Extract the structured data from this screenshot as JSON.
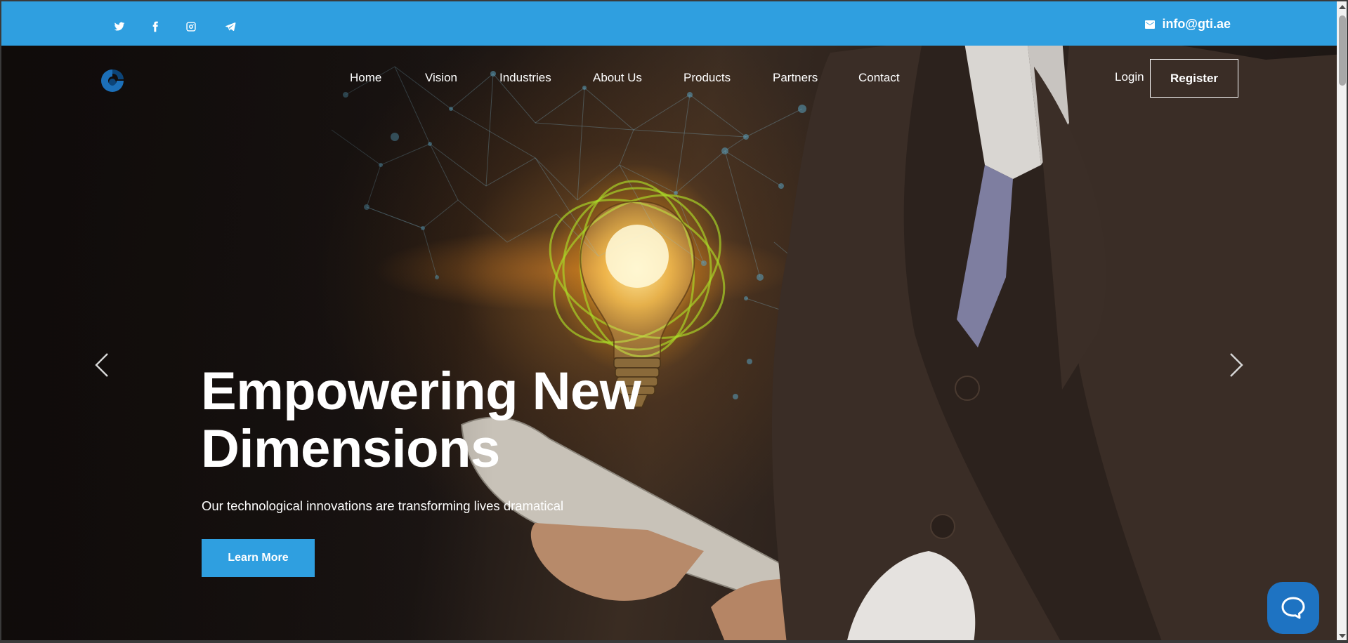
{
  "topbar": {
    "social": [
      {
        "icon": "twitter-icon"
      },
      {
        "icon": "facebook-icon"
      },
      {
        "icon": "instagram-icon"
      },
      {
        "icon": "telegram-icon"
      }
    ],
    "email": "info@gti.ae",
    "bg_color": "#2f9fe0"
  },
  "nav": {
    "items": [
      "Home",
      "Vision",
      "Industries",
      "About Us",
      "Products",
      "Partners",
      "Contact"
    ],
    "login": "Login",
    "register": "Register"
  },
  "hero": {
    "title_line1": "Empowering New",
    "title_line2": "Dimensions",
    "subtitle": "Our technological innovations are transforming lives dramatical",
    "cta": "Learn More",
    "cta_color": "#2f9fe0"
  },
  "chat": {
    "icon": "chat-bubble-icon",
    "color": "#1e73c2"
  }
}
